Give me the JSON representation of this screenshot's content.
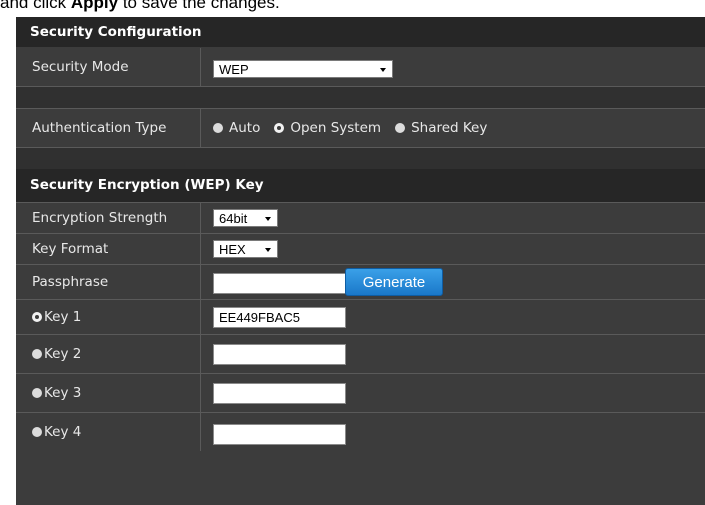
{
  "caption": {
    "prefix": "and click ",
    "bold": "Apply",
    "suffix": " to save the changes."
  },
  "security_config": {
    "title": "Security Configuration",
    "security_mode": {
      "label": "Security Mode",
      "value": "WEP"
    },
    "authentication": {
      "label": "Authentication Type",
      "options": [
        "Auto",
        "Open System",
        "Shared Key"
      ],
      "selected": "Open System"
    }
  },
  "wep": {
    "title": "Security Encryption (WEP) Key",
    "strength": {
      "label": "Encryption Strength",
      "value": "64bit"
    },
    "key_format": {
      "label": "Key Format",
      "value": "HEX"
    },
    "passphrase": {
      "label": "Passphrase",
      "value": "",
      "button": "Generate"
    },
    "keys": [
      {
        "label": "Key 1",
        "value": "EE449FBAC5",
        "selected": true
      },
      {
        "label": "Key 2",
        "value": "",
        "selected": false
      },
      {
        "label": "Key 3",
        "value": "",
        "selected": false
      },
      {
        "label": "Key 4",
        "value": "",
        "selected": false
      }
    ]
  }
}
